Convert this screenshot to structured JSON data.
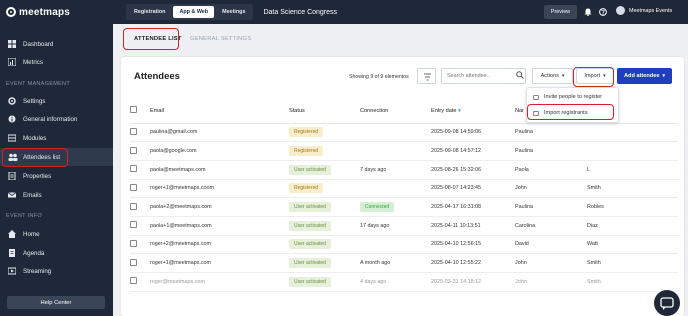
{
  "sidebar": {
    "logo": "meetmaps",
    "items_top": [
      {
        "label": "Dashboard",
        "icon": "dashboard-icon"
      },
      {
        "label": "Metrics",
        "icon": "metrics-icon"
      }
    ],
    "section_event_management": "EVENT MANAGEMENT",
    "items_event": [
      {
        "label": "Settings",
        "icon": "gear-icon"
      },
      {
        "label": "General information",
        "icon": "info-icon"
      },
      {
        "label": "Modules",
        "icon": "modules-icon"
      },
      {
        "label": "Attendees list",
        "icon": "people-icon"
      },
      {
        "label": "Properties",
        "icon": "properties-icon"
      },
      {
        "label": "Emails",
        "icon": "email-icon"
      }
    ],
    "section_event_info": "EVENT INFO",
    "items_info": [
      {
        "label": "Home",
        "icon": "home-icon"
      },
      {
        "label": "Agenda",
        "icon": "agenda-icon"
      },
      {
        "label": "Streaming",
        "icon": "streaming-icon"
      }
    ],
    "help_center": "Help Center"
  },
  "topbar": {
    "tabs": [
      "Registration",
      "App & Web",
      "Meetings"
    ],
    "event_title": "Data Science Congress",
    "preview": "Preview",
    "user_name": "Meetmaps Events"
  },
  "page_tabs": {
    "attendee_list": "ATTENDEE LIST",
    "general_settings": "GENERAL SETTINGS"
  },
  "panel": {
    "title": "Attendees",
    "showing": "Showing 9 of 9 elementos",
    "search_placeholder": "Search attendee...",
    "actions": "Actions",
    "import": "Import",
    "add_attendee": "Add attendee"
  },
  "import_menu": {
    "invite": "Invite people to register",
    "import_registrants": "Import registrants"
  },
  "table": {
    "headers": {
      "email": "Email",
      "status": "Status",
      "connection": "Connection",
      "entry_date": "Entry date",
      "name": "Nar",
      "lastname": "name"
    },
    "rows": [
      {
        "email": "paulina@gmail.com",
        "status": "Registered",
        "connection": "",
        "date": "2025-09-08 14:59:06",
        "name": "Paulina",
        "last": ""
      },
      {
        "email": "paola@google.com",
        "status": "Registered",
        "connection": "",
        "date": "2025-09-08 14:57:12",
        "name": "Paulina",
        "last": ""
      },
      {
        "email": "paola@meetmaps.com",
        "status": "User activated",
        "connection": "7 days ago",
        "date": "2025-08-26 15:32:06",
        "name": "Paola",
        "last": "L"
      },
      {
        "email": "roger+1@meetmaps.coom",
        "status": "Registered",
        "connection": "",
        "date": "2025-08-07 14:23:45",
        "name": "John",
        "last": "Smith"
      },
      {
        "email": "paola+2@meetmaps.com",
        "status": "User activated",
        "connection": "Connected",
        "date": "2025-04-17 16:31:08",
        "name": "Paulina",
        "last": "Robles"
      },
      {
        "email": "paola+1@meetmaps.com",
        "status": "User activated",
        "connection": "17 days ago",
        "date": "2025-04-11 10:13:51",
        "name": "Carolina",
        "last": "Diaz"
      },
      {
        "email": "roger+2@meetmaps.com",
        "status": "User activated",
        "connection": "",
        "date": "2025-04-10 12:56:15",
        "name": "David",
        "last": "Watt"
      },
      {
        "email": "roger+1@meetmaps.com",
        "status": "User activated",
        "connection": "A month ago",
        "date": "2025-04-10 12:55:22",
        "name": "John",
        "last": "Smith"
      },
      {
        "email": "roger@meetmaps.com",
        "status": "User activated",
        "connection": "4 days ago",
        "date": "2025-03-31 14:18:12",
        "name": "John",
        "last": "Smith"
      }
    ]
  },
  "colors": {
    "sidebar": "#1e2838",
    "primary": "#1f3fbf",
    "highlight": "#d61f2c"
  }
}
